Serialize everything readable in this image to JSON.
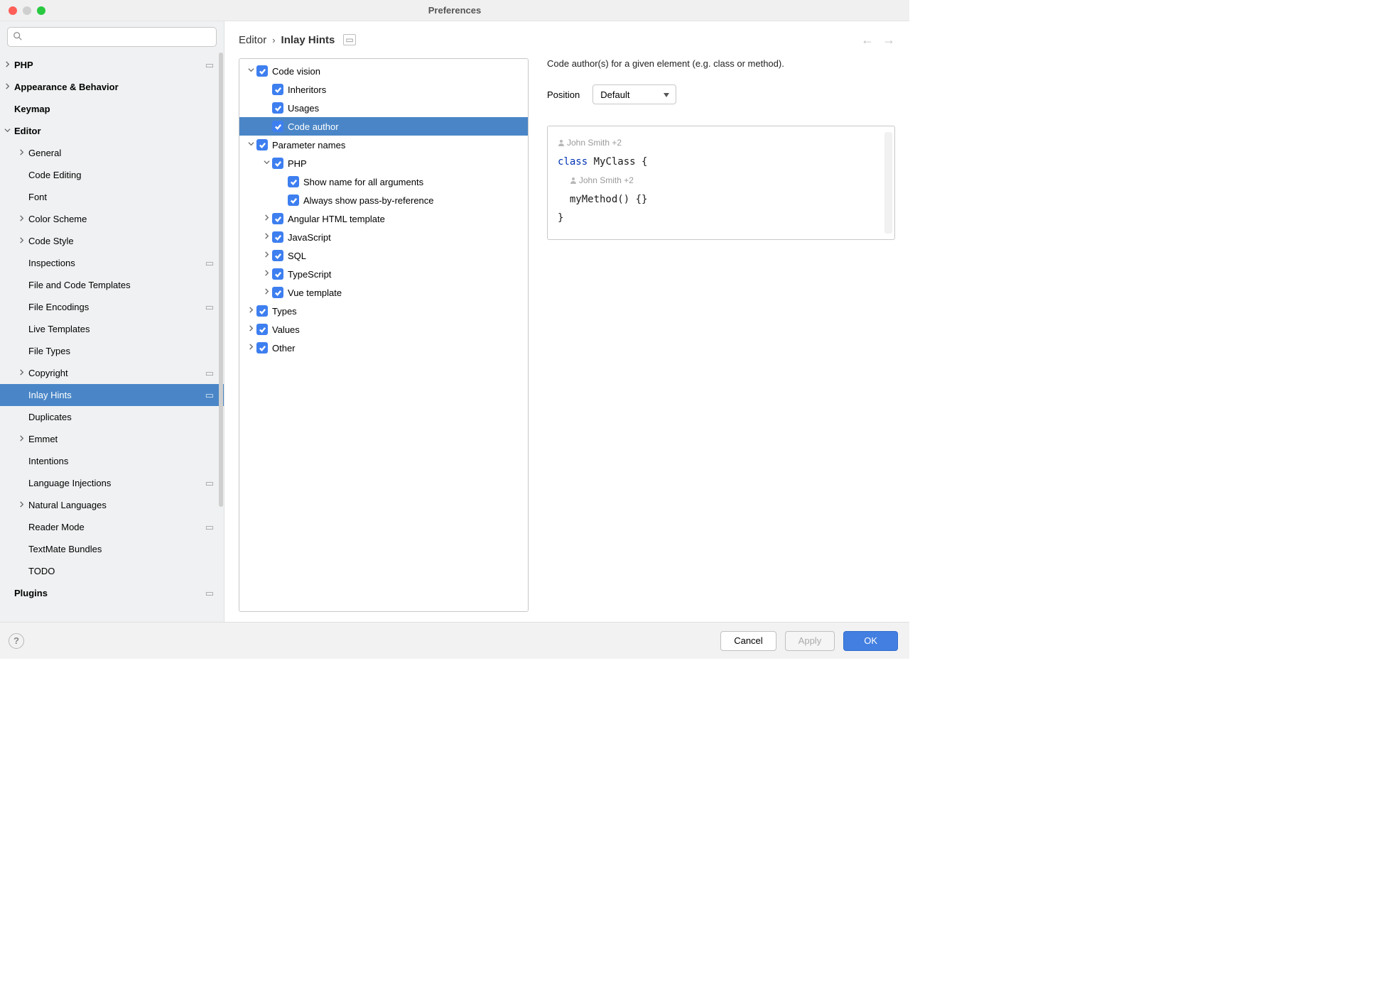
{
  "window_title": "Preferences",
  "search": {
    "placeholder": ""
  },
  "sidebar": {
    "items": [
      {
        "label": "PHP",
        "bold": true,
        "arrow": "right",
        "indent": 0,
        "badge": true
      },
      {
        "label": "Appearance & Behavior",
        "bold": true,
        "arrow": "right",
        "indent": 0
      },
      {
        "label": "Keymap",
        "bold": true,
        "arrow": "",
        "indent": 0
      },
      {
        "label": "Editor",
        "bold": true,
        "arrow": "down",
        "indent": 0
      },
      {
        "label": "General",
        "arrow": "right",
        "indent": 1
      },
      {
        "label": "Code Editing",
        "arrow": "",
        "indent": 1
      },
      {
        "label": "Font",
        "arrow": "",
        "indent": 1
      },
      {
        "label": "Color Scheme",
        "arrow": "right",
        "indent": 1
      },
      {
        "label": "Code Style",
        "arrow": "right",
        "indent": 1
      },
      {
        "label": "Inspections",
        "arrow": "",
        "indent": 1,
        "badge": true
      },
      {
        "label": "File and Code Templates",
        "arrow": "",
        "indent": 1
      },
      {
        "label": "File Encodings",
        "arrow": "",
        "indent": 1,
        "badge": true
      },
      {
        "label": "Live Templates",
        "arrow": "",
        "indent": 1
      },
      {
        "label": "File Types",
        "arrow": "",
        "indent": 1
      },
      {
        "label": "Copyright",
        "arrow": "right",
        "indent": 1,
        "badge": true
      },
      {
        "label": "Inlay Hints",
        "arrow": "",
        "indent": 1,
        "badge": true,
        "selected": true
      },
      {
        "label": "Duplicates",
        "arrow": "",
        "indent": 1
      },
      {
        "label": "Emmet",
        "arrow": "right",
        "indent": 1
      },
      {
        "label": "Intentions",
        "arrow": "",
        "indent": 1
      },
      {
        "label": "Language Injections",
        "arrow": "",
        "indent": 1,
        "badge": true
      },
      {
        "label": "Natural Languages",
        "arrow": "right",
        "indent": 1
      },
      {
        "label": "Reader Mode",
        "arrow": "",
        "indent": 1,
        "badge": true
      },
      {
        "label": "TextMate Bundles",
        "arrow": "",
        "indent": 1
      },
      {
        "label": "TODO",
        "arrow": "",
        "indent": 1
      },
      {
        "label": "Plugins",
        "bold": true,
        "arrow": "",
        "indent": 0,
        "badge": true
      }
    ]
  },
  "breadcrumb": {
    "parent": "Editor",
    "current": "Inlay Hints"
  },
  "tree": {
    "items": [
      {
        "arrow": "down",
        "indent": 0,
        "label": "Code vision"
      },
      {
        "arrow": "",
        "indent": 1,
        "label": "Inheritors"
      },
      {
        "arrow": "",
        "indent": 1,
        "label": "Usages"
      },
      {
        "arrow": "",
        "indent": 1,
        "label": "Code author",
        "selected": true
      },
      {
        "arrow": "down",
        "indent": 0,
        "label": "Parameter names"
      },
      {
        "arrow": "down",
        "indent": 1,
        "label": "PHP"
      },
      {
        "arrow": "",
        "indent": 2,
        "label": "Show name for all arguments"
      },
      {
        "arrow": "",
        "indent": 2,
        "label": "Always show pass-by-reference"
      },
      {
        "arrow": "right",
        "indent": 1,
        "label": "Angular HTML template"
      },
      {
        "arrow": "right",
        "indent": 1,
        "label": "JavaScript"
      },
      {
        "arrow": "right",
        "indent": 1,
        "label": "SQL"
      },
      {
        "arrow": "right",
        "indent": 1,
        "label": "TypeScript"
      },
      {
        "arrow": "right",
        "indent": 1,
        "label": "Vue template"
      },
      {
        "arrow": "right",
        "indent": 0,
        "label": "Types"
      },
      {
        "arrow": "right",
        "indent": 0,
        "label": "Values"
      },
      {
        "arrow": "right",
        "indent": 0,
        "label": "Other"
      }
    ]
  },
  "detail": {
    "description": "Code author(s) for a given element (e.g. class or method).",
    "position_label": "Position",
    "position_value": "Default",
    "code": {
      "author1": "John Smith +2",
      "line1_kw": "class",
      "line1_rest": " MyClass {",
      "author2": "John Smith +2",
      "line2": "  myMethod() {}",
      "line3": "}"
    }
  },
  "footer": {
    "cancel": "Cancel",
    "apply": "Apply",
    "ok": "OK"
  }
}
